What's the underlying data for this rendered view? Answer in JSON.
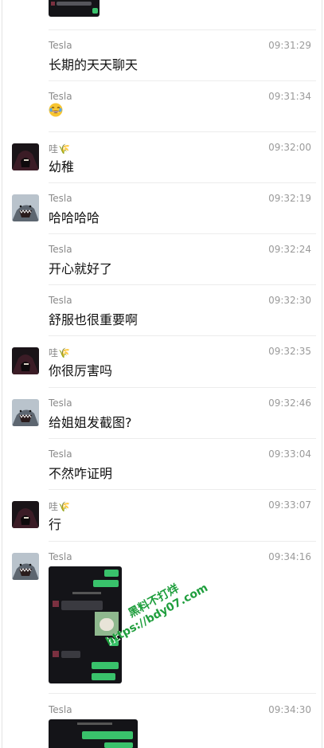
{
  "chat": {
    "messages": [
      {
        "sender": "Tesla",
        "time": "09:31:29",
        "text": "长期的天天聊天"
      },
      {
        "sender": "Tesla",
        "time": "09:31:34",
        "emoji": "laughing-tears-emoji"
      },
      {
        "sender": "哇🌾",
        "time": "09:32:00",
        "text": "幼稚"
      },
      {
        "sender": "Tesla",
        "time": "09:32:19",
        "text": "哈哈哈哈"
      },
      {
        "sender": "Tesla",
        "time": "09:32:24",
        "text": "开心就好了"
      },
      {
        "sender": "Tesla",
        "time": "09:32:30",
        "text": "舒服也很重要啊"
      },
      {
        "sender": "哇🌾",
        "time": "09:32:35",
        "text": "你很厉害吗"
      },
      {
        "sender": "Tesla",
        "time": "09:32:46",
        "text": "给姐姐发截图?"
      },
      {
        "sender": "Tesla",
        "time": "09:33:04",
        "text": "不然咋证明"
      },
      {
        "sender": "哇🌾",
        "time": "09:33:07",
        "text": "行"
      },
      {
        "sender": "Tesla",
        "time": "09:34:16",
        "image": "chat-screenshot"
      },
      {
        "sender": "Tesla",
        "time": "09:34:30",
        "image": "chat-screenshot"
      }
    ]
  },
  "watermark": {
    "line1": "黑料不打烊",
    "line2": "https://bdy07.com"
  },
  "colors": {
    "bubble_green": "#39c26b",
    "watermark": "#1f9e3d",
    "timestamp": "#9a9a9a"
  }
}
